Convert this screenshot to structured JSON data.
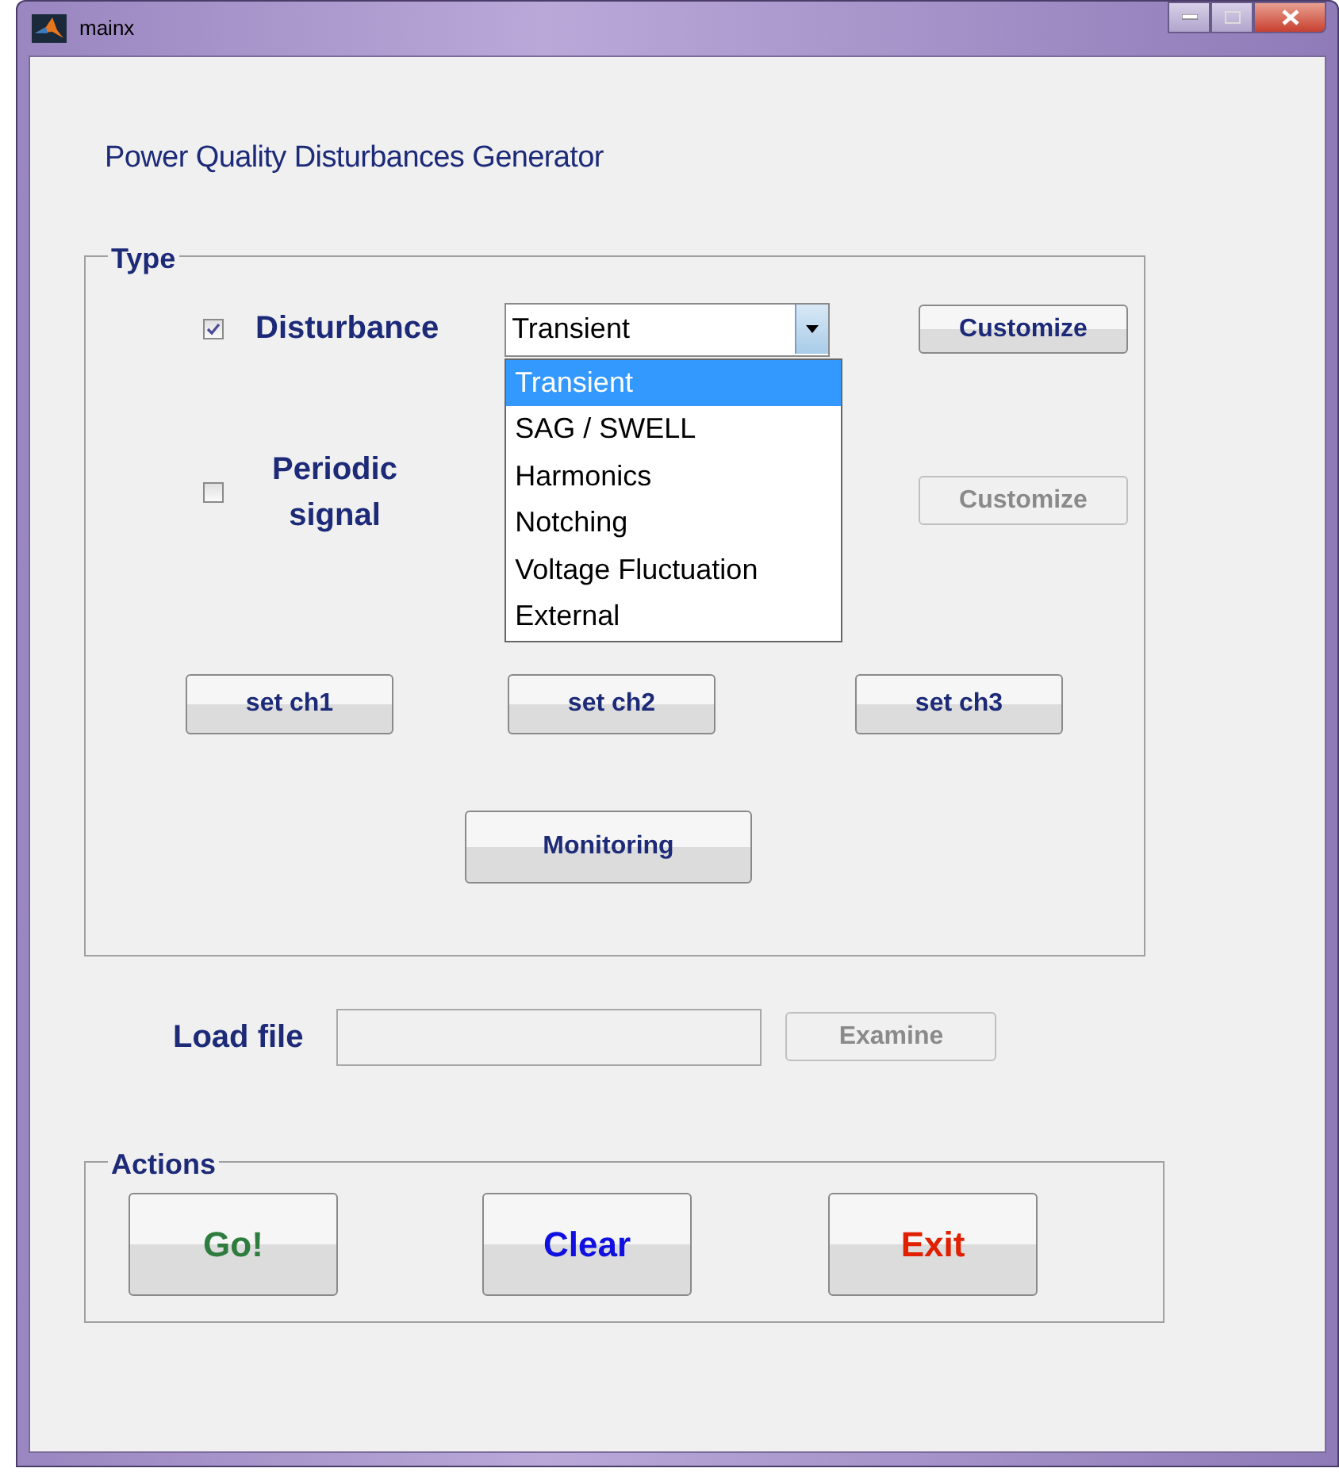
{
  "window": {
    "title": "mainx"
  },
  "heading": "Power Quality Disturbances Generator",
  "type_panel": {
    "legend": "Type",
    "rows": [
      {
        "checked": true,
        "label": "Disturbance",
        "select": {
          "value": "Transient",
          "expanded": true,
          "options": [
            {
              "label": "Transient",
              "selected": true
            },
            {
              "label": "SAG / SWELL",
              "selected": false
            },
            {
              "label": "Harmonics",
              "selected": false
            },
            {
              "label": "Notching",
              "selected": false
            },
            {
              "label": "Voltage Fluctuation",
              "selected": false
            },
            {
              "label": "External",
              "selected": false
            }
          ]
        },
        "button": {
          "label": "Customize",
          "disabled": false
        }
      },
      {
        "checked": false,
        "label": "Periodic signal",
        "button": {
          "label": "Customize",
          "disabled": true
        }
      }
    ],
    "channel_buttons": [
      "set ch1",
      "set ch2",
      "set ch3"
    ],
    "monitoring_button": "Monitoring"
  },
  "load_file": {
    "label": "Load file",
    "disabled": true,
    "button": {
      "label": "Examine",
      "disabled": true
    }
  },
  "actions_panel": {
    "legend": "Actions",
    "buttons": [
      {
        "label": "Go!",
        "color": "#2e7d3e"
      },
      {
        "label": "Clear",
        "color": "#1010e0"
      },
      {
        "label": "Exit",
        "color": "#e02000"
      }
    ]
  }
}
